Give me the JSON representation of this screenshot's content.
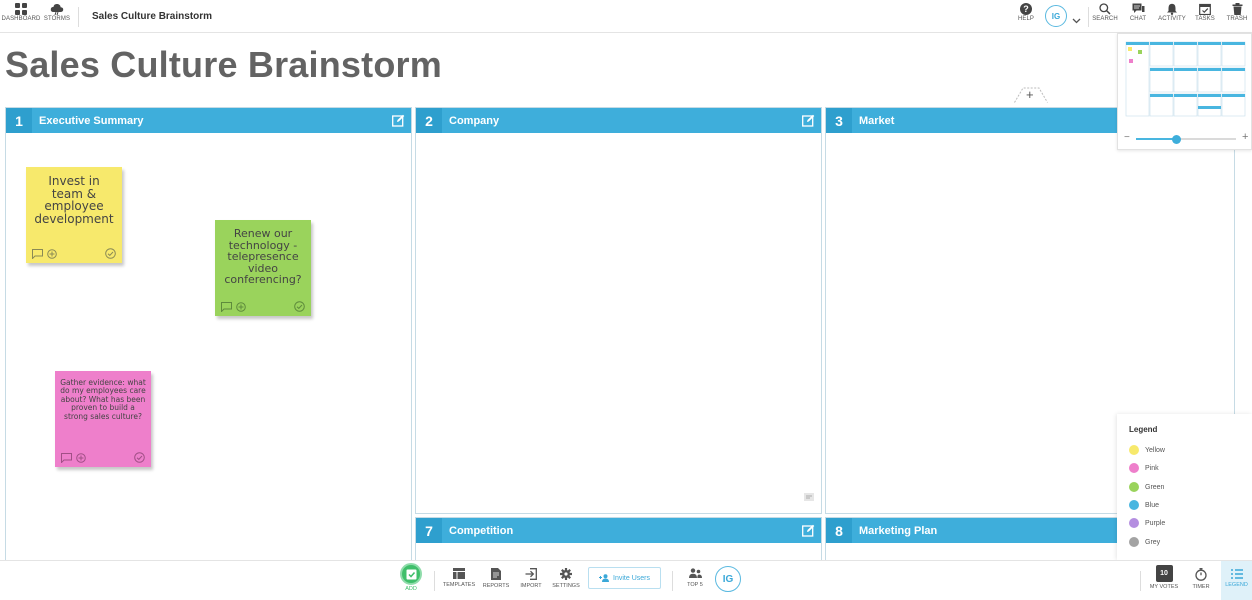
{
  "topbar": {
    "dashboard_label": "DASHBOARD",
    "storms_label": "STORMS",
    "board_title": "Sales Culture Brainstorm",
    "help_label": "HELP",
    "user_initials": "IG",
    "search_label": "SEARCH",
    "chat_label": "CHAT",
    "activity_label": "ACTIVITY",
    "tasks_label": "TASKS",
    "trash_label": "TRASH"
  },
  "page": {
    "title": "Sales Culture Brainstorm",
    "add_section_symbol": "+"
  },
  "sections": [
    {
      "number": "1",
      "title": "Executive Summary"
    },
    {
      "number": "2",
      "title": "Company"
    },
    {
      "number": "3",
      "title": "Market"
    },
    {
      "number": "7",
      "title": "Competition"
    },
    {
      "number": "8",
      "title": "Marketing Plan"
    }
  ],
  "notes": [
    {
      "text": "Invest in team & employee development",
      "color": "#f7e96c"
    },
    {
      "text": "Renew our technology - telepresence video conferencing?",
      "color": "#9ad35c"
    },
    {
      "text": "Gather evidence: what do my employees care about? What has been proven to build a strong sales culture?",
      "color": "#ee7fcb"
    }
  ],
  "minimap": {
    "zoom_minus": "−",
    "zoom_plus": "+",
    "zoom_level": 0.4
  },
  "legend": {
    "title": "Legend",
    "items": [
      {
        "label": "Yellow",
        "color": "#f7e96c"
      },
      {
        "label": "Pink",
        "color": "#ee7fcb"
      },
      {
        "label": "Green",
        "color": "#9ad35c"
      },
      {
        "label": "Blue",
        "color": "#49b6e0"
      },
      {
        "label": "Purple",
        "color": "#b48ee0"
      },
      {
        "label": "Grey",
        "color": "#a3a3a3"
      }
    ]
  },
  "bottombar": {
    "add_label": "ADD",
    "templates_label": "TEMPLATES",
    "reports_label": "REPORTS",
    "import_label": "IMPORT",
    "settings_label": "SETTINGS",
    "invite_label": "Invite Users",
    "top5_label": "TOP 5",
    "user_initials": "IG",
    "votes_count": "10",
    "votes_label": "MY VOTES",
    "timer_label": "TIMER",
    "legend_label": "LEGEND"
  },
  "colors": {
    "accent": "#3eaedb",
    "accent_dark": "#2e9fce",
    "title_grey": "#636363",
    "add_green": "#3fbf6a"
  }
}
